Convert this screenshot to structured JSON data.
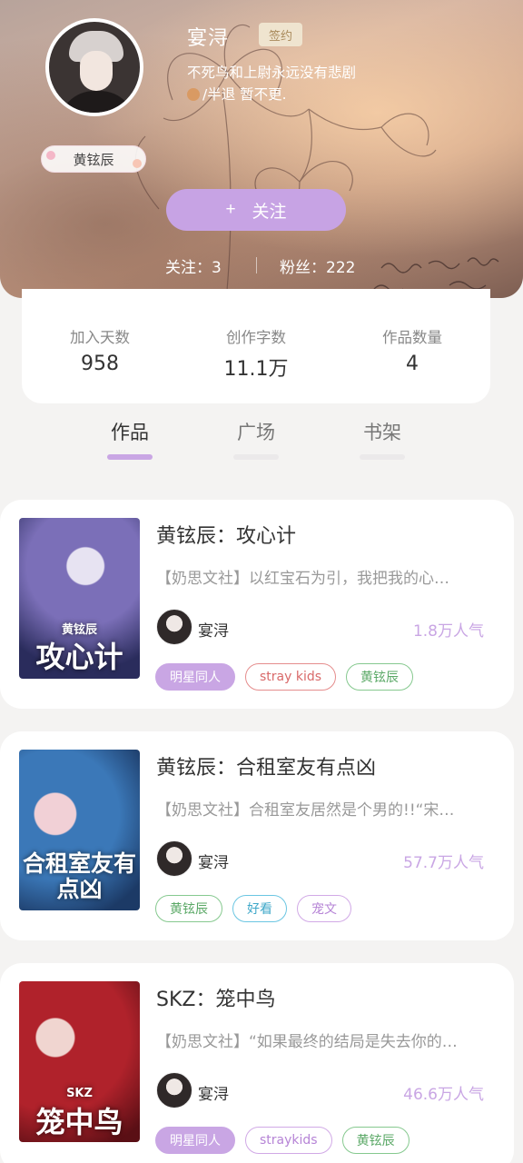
{
  "profile": {
    "username": "宴浔",
    "signed_badge": "签约",
    "bio_line1": "不死鸟和上尉永远没有悲剧",
    "bio_line2": "/半退 暂不更.",
    "name_tag": "黄铉辰",
    "follow_button": "关注",
    "follow_icon": "+",
    "following": "关注：3",
    "fans": "粉丝：222"
  },
  "stats": [
    {
      "label": "加入天数",
      "value": "958"
    },
    {
      "label": "创作字数",
      "value": "11.1万"
    },
    {
      "label": "作品数量",
      "value": "4"
    }
  ],
  "tabs": [
    {
      "label": "作品",
      "active": true
    },
    {
      "label": "广场",
      "active": false
    },
    {
      "label": "书架",
      "active": false
    }
  ],
  "works": [
    {
      "title": "黄铉辰：攻心计",
      "description": "【奶思文社】以红宝石为引，我把我的心…",
      "author": "宴浔",
      "popularity": "1.8万人气",
      "cover_text": "攻心计",
      "cover_subtitle": "黄铉辰",
      "cover_colors": [
        "#2a2c5c",
        "#7b6fb8",
        "#e7e3f2"
      ],
      "tags": [
        {
          "label": "明星同人",
          "style": "purple-fill"
        },
        {
          "label": "stray kids",
          "style": "red"
        },
        {
          "label": "黄铉辰",
          "style": "green"
        }
      ]
    },
    {
      "title": "黄铉辰：合租室友有点凶",
      "description": "【奶思文社】合租室友居然是个男的!!“宋…",
      "author": "宴浔",
      "popularity": "57.7万人气",
      "cover_text": "合租室友有点凶",
      "cover_subtitle": "",
      "cover_colors": [
        "#1c3a66",
        "#3b78b8",
        "#f1d0d6"
      ],
      "tags": [
        {
          "label": "黄铉辰",
          "style": "green"
        },
        {
          "label": "好看",
          "style": "blue"
        },
        {
          "label": "宠文",
          "style": "purple"
        }
      ]
    },
    {
      "title": "SKZ：笼中鸟",
      "description": "【奶思文社】“如果最终的结局是失去你的…",
      "author": "宴浔",
      "popularity": "46.6万人气",
      "cover_text": "笼中鸟",
      "cover_subtitle": "SKZ",
      "cover_colors": [
        "#5a0f15",
        "#b0222b",
        "#f0d5d0"
      ],
      "tags": [
        {
          "label": "明星同人",
          "style": "purple-fill"
        },
        {
          "label": "straykids",
          "style": "purple"
        },
        {
          "label": "黄铉辰",
          "style": "green"
        }
      ]
    }
  ]
}
